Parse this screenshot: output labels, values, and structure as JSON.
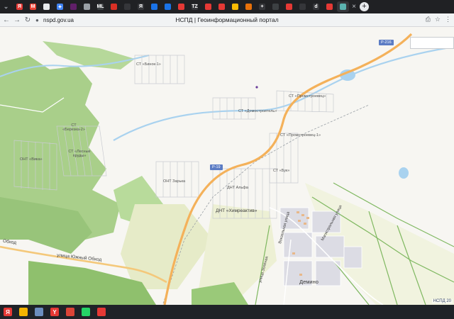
{
  "browser": {
    "tabs": [
      {
        "name": "tab-yandex",
        "glyph": "Я",
        "color": "#e53935"
      },
      {
        "name": "tab-gmail",
        "glyph": "M",
        "color": "#ea4335"
      },
      {
        "name": "tab-doc-1",
        "glyph": "",
        "color": "#e8eaed"
      },
      {
        "name": "tab-sparkle",
        "glyph": "✦",
        "color": "#4285f4"
      },
      {
        "name": "tab-slack",
        "glyph": "",
        "color": "#611f69"
      },
      {
        "name": "tab-grid",
        "glyph": "",
        "color": "#9aa0a6"
      },
      {
        "name": "tab-ml",
        "glyph": "ML",
        "color": "#3c4043"
      },
      {
        "name": "tab-record",
        "glyph": "",
        "color": "#d93025"
      },
      {
        "name": "tab-blank-1",
        "glyph": "",
        "color": "#35363a"
      },
      {
        "name": "tab-ya",
        "glyph": "Я",
        "color": "#35363a"
      },
      {
        "name": "tab-chrome",
        "glyph": "",
        "color": "#1a73e8"
      },
      {
        "name": "tab-blue-1",
        "glyph": "",
        "color": "#1a73e8"
      },
      {
        "name": "tab-red-1",
        "glyph": "",
        "color": "#e53935"
      },
      {
        "name": "tab-tz",
        "glyph": "TZ",
        "color": "#35363a"
      },
      {
        "name": "tab-red-2",
        "glyph": "",
        "color": "#e53935"
      },
      {
        "name": "tab-red-3",
        "glyph": "",
        "color": "#e53935"
      },
      {
        "name": "tab-play",
        "glyph": "",
        "color": "#fbbc04"
      },
      {
        "name": "tab-folder",
        "glyph": "",
        "color": "#e8710a"
      },
      {
        "name": "tab-plus",
        "glyph": "+",
        "color": "#35363a"
      },
      {
        "name": "tab-warning",
        "glyph": "",
        "color": "#3c4043"
      },
      {
        "name": "tab-red-4",
        "glyph": "",
        "color": "#e53935"
      },
      {
        "name": "tab-blank-2",
        "glyph": "",
        "color": "#35363a"
      },
      {
        "name": "tab-d",
        "glyph": "d",
        "color": "#35363a"
      },
      {
        "name": "tab-red-5",
        "glyph": "",
        "color": "#e53935"
      },
      {
        "name": "tab-active-map",
        "glyph": "",
        "color": "#5bb3b0",
        "active": true
      }
    ],
    "url": "nspd.gov.ua",
    "title": "НСПД | Геоинформационный портал"
  },
  "map": {
    "labels": [
      {
        "text": "СТ «Бинок-1»"
      },
      {
        "text": "СТ «Промстроевец»"
      },
      {
        "text": "СТ «Домостроитель»"
      },
      {
        "text": "СТ «Промстроевец-1»"
      },
      {
        "text": "СТ «Березка-2»"
      },
      {
        "text": "СТ «Лесные пруды»"
      },
      {
        "text": "ОНТ «Вика»"
      },
      {
        "text": "СТ «Бук»"
      },
      {
        "text": "ОНТ Зарька"
      },
      {
        "text": "ДНТ Альфа"
      },
      {
        "text": "ДНТ «Химреактив»"
      }
    ],
    "roads": {
      "r216": "Р-216",
      "r19": "Р-19",
      "south_bypass": "улица Южный Обход",
      "south_bypass_west": "Обход",
      "vokzalnaya": "Вокзальная улица",
      "magistralnaya": "Магистральная улица",
      "zelenaya": "улица Зелёная"
    },
    "town": "Демино",
    "attribution": "НСПД 20"
  },
  "taskbar": {
    "items": [
      {
        "name": "taskbar-yandex",
        "glyph": "Я",
        "color": "#e53935"
      },
      {
        "name": "taskbar-explorer",
        "glyph": "",
        "color": "#f4b400"
      },
      {
        "name": "taskbar-monitor",
        "glyph": "",
        "color": "#6c8ebf"
      },
      {
        "name": "taskbar-yandex-browser",
        "glyph": "Y",
        "color": "#e53935"
      },
      {
        "name": "taskbar-chrome",
        "glyph": "",
        "color": "#db4437"
      },
      {
        "name": "taskbar-whatsapp",
        "glyph": "",
        "color": "#25d366"
      },
      {
        "name": "taskbar-recorder",
        "glyph": "",
        "color": "#e53935"
      }
    ]
  }
}
